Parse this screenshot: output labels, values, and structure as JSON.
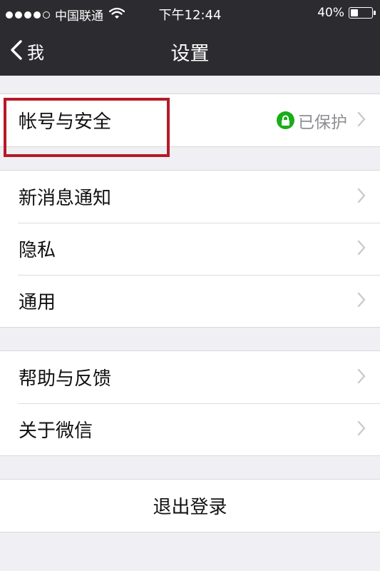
{
  "status_bar": {
    "carrier": "中国联通",
    "time": "下午12:44",
    "battery": "40%",
    "battery_level": 0.4,
    "signal_icon": "signal-dots-icon",
    "wifi_icon": "wifi-icon"
  },
  "nav": {
    "back_label": "我",
    "back_icon": "chevron-left-icon",
    "title": "设置"
  },
  "account": {
    "label": "帐号与安全",
    "status": "已保护",
    "status_icon": "lock-icon",
    "status_color": "#1aad19"
  },
  "group2": [
    {
      "label": "新消息通知"
    },
    {
      "label": "隐私"
    },
    {
      "label": "通用"
    }
  ],
  "group3": [
    {
      "label": "帮助与反馈"
    },
    {
      "label": "关于微信"
    }
  ],
  "logout": {
    "label": "退出登录"
  },
  "colors": {
    "bar_background": "#2c2c30",
    "page_background": "#efeff4",
    "highlight_border": "#b51a28"
  }
}
